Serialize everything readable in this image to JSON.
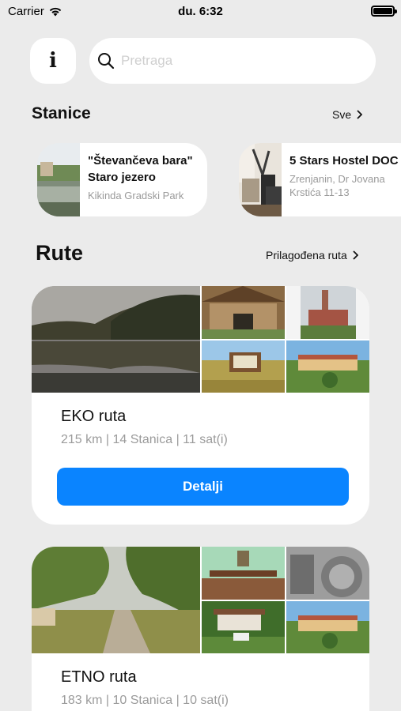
{
  "status_bar": {
    "carrier": "Carrier",
    "time": "du. 6:32"
  },
  "header": {
    "info_label": "i",
    "search_placeholder": "Pretraga"
  },
  "stations_section": {
    "title": "Stanice",
    "see_all": "Sve",
    "items": [
      {
        "name": "\"Števančeva bara\"\nStaro jezero",
        "address": "Kikinda Gradski Park"
      },
      {
        "name": "5 Stars Hostel DOC",
        "address": "Zrenjanin, Dr Jovana\nKrstića 11-13"
      }
    ]
  },
  "routes_section": {
    "title": "Rute",
    "custom_link": "Prilagođena ruta",
    "items": [
      {
        "name": "EKO ruta",
        "meta": "215 km | 14 Stanica | 11 sat(i)",
        "button": "Detalji"
      },
      {
        "name": "ETNO ruta",
        "meta": "183 km | 10 Stanica | 10 sat(i)"
      }
    ]
  },
  "colors": {
    "background": "#ebebeb",
    "card": "#ffffff",
    "accent": "#0a84ff",
    "muted": "#9b9b9b"
  },
  "icons": [
    "wifi-icon",
    "battery-icon",
    "info-icon",
    "search-icon",
    "chevron-right-icon"
  ]
}
